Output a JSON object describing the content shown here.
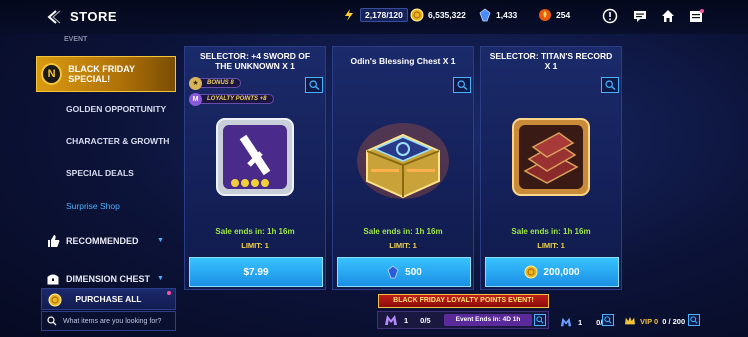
{
  "header": {
    "title": "STORE",
    "energy": "2,178/120",
    "gold": "6,535,322",
    "crystals": "1,433",
    "tickets": "254"
  },
  "sidebar": {
    "partial_item": "EVENT",
    "selected": "BLACK FRIDAY SPECIAL!",
    "items": [
      "GOLDEN OPPORTUNITY",
      "CHARACTER & GROWTH",
      "SPECIAL DEALS"
    ],
    "surprise": "Surprise Shop",
    "recommended": "RECOMMENDED",
    "dimension": "DIMENSION CHEST",
    "purchase_all": "PURCHASE ALL",
    "search_placeholder": "What items are you looking for?"
  },
  "cards": [
    {
      "title": "SELECTOR: +4 SWORD OF THE UNKNOWN X 1",
      "bonus": "BONUS 8",
      "loyalty": "LOYALTY POINTS +8",
      "sale": "Sale ends in: 1h 16m",
      "limit": "LIMIT: 1",
      "price": "$7.99"
    },
    {
      "title": "Odin's Blessing Chest X 1",
      "sale": "Sale ends in: 1h 16m",
      "limit": "LIMIT: 1",
      "price": "500"
    },
    {
      "title": "SELECTOR: TITAN'S RECORD X 1",
      "sale": "Sale ends in: 1h 16m",
      "limit": "LIMIT: 1",
      "price": "200,000"
    }
  ],
  "event": {
    "banner": "BLACK FRIDAY LOYALTY POINTS EVENT!",
    "level": "1",
    "progress": "0/5",
    "timer": "Event Ends in: 4D 1h"
  },
  "bottom_right": {
    "m_level": "1",
    "m_progress": "0/5",
    "vip": "VIP 0",
    "vip_progress": "0 / 200"
  },
  "colors": {
    "accent_blue": "#1b8fe4",
    "gold": "#d99a10",
    "sale_green": "#9de63e",
    "limit_yellow": "#f2d447"
  }
}
